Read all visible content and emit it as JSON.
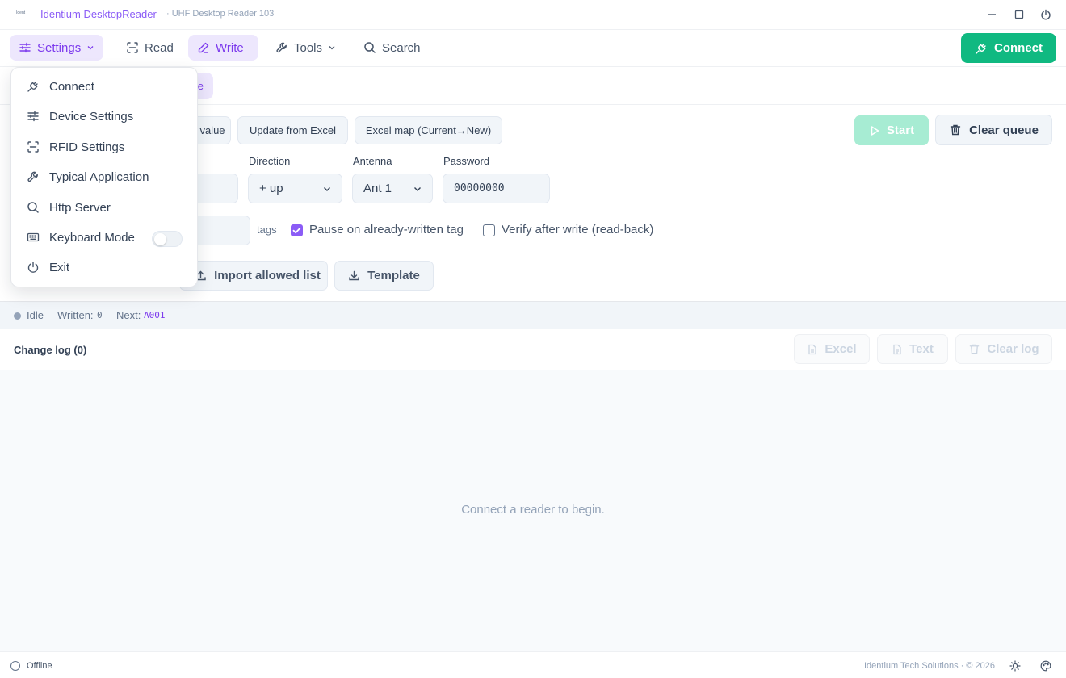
{
  "titlebar": {
    "logo_text": "Ident",
    "app_name": "Identium DesktopReader",
    "subtitle": "· UHF Desktop Reader 103"
  },
  "nav": {
    "settings": "Settings",
    "read": "Read",
    "write": "Write",
    "tools": "Tools",
    "search": "Search",
    "connect": "Connect"
  },
  "mode_chip": "e",
  "buttons": {
    "value": "value",
    "update_excel": "Update from Excel",
    "excel_map": "Excel map (Current→New)",
    "start": "Start",
    "clear_queue": "Clear queue",
    "import_allowed": "Import allowed list",
    "template": "Template"
  },
  "fields": {
    "direction_label": "Direction",
    "direction_value": "+ up",
    "antenna_label": "Antenna",
    "antenna_value": "Ant 1",
    "password_label": "Password",
    "password_value": "00000000",
    "tags_suffix": "tags"
  },
  "options": {
    "pause_label": "Pause on already-written tag",
    "pause_checked": true,
    "verify_label": "Verify after write (read-back)",
    "verify_checked": false
  },
  "status": {
    "state": "Idle",
    "written_label": "Written:",
    "written_value": "0",
    "next_label": "Next:",
    "next_value": "A001"
  },
  "log": {
    "title": "Change log (0)",
    "excel": "Excel",
    "text": "Text",
    "clear": "Clear log",
    "empty_message": "Connect a reader to begin."
  },
  "footer": {
    "state": "Offline",
    "copyright": "Identium Tech Solutions · © 2026"
  },
  "menu": {
    "items": [
      {
        "label": "Connect",
        "icon": "plug-icon"
      },
      {
        "label": "Device Settings",
        "icon": "sliders-icon"
      },
      {
        "label": "RFID Settings",
        "icon": "scan-icon"
      },
      {
        "label": "Typical Application",
        "icon": "wrench-icon"
      },
      {
        "label": "Http Server",
        "icon": "search-icon"
      },
      {
        "label": "Keyboard Mode",
        "icon": "keyboard-icon",
        "toggle": false
      },
      {
        "label": "Exit",
        "icon": "power-icon"
      }
    ]
  },
  "colors": {
    "accent": "#8b5cf6",
    "accent_bg": "#ede7fd",
    "connect": "#10b981",
    "start_disabled": "#a7ecd3"
  }
}
